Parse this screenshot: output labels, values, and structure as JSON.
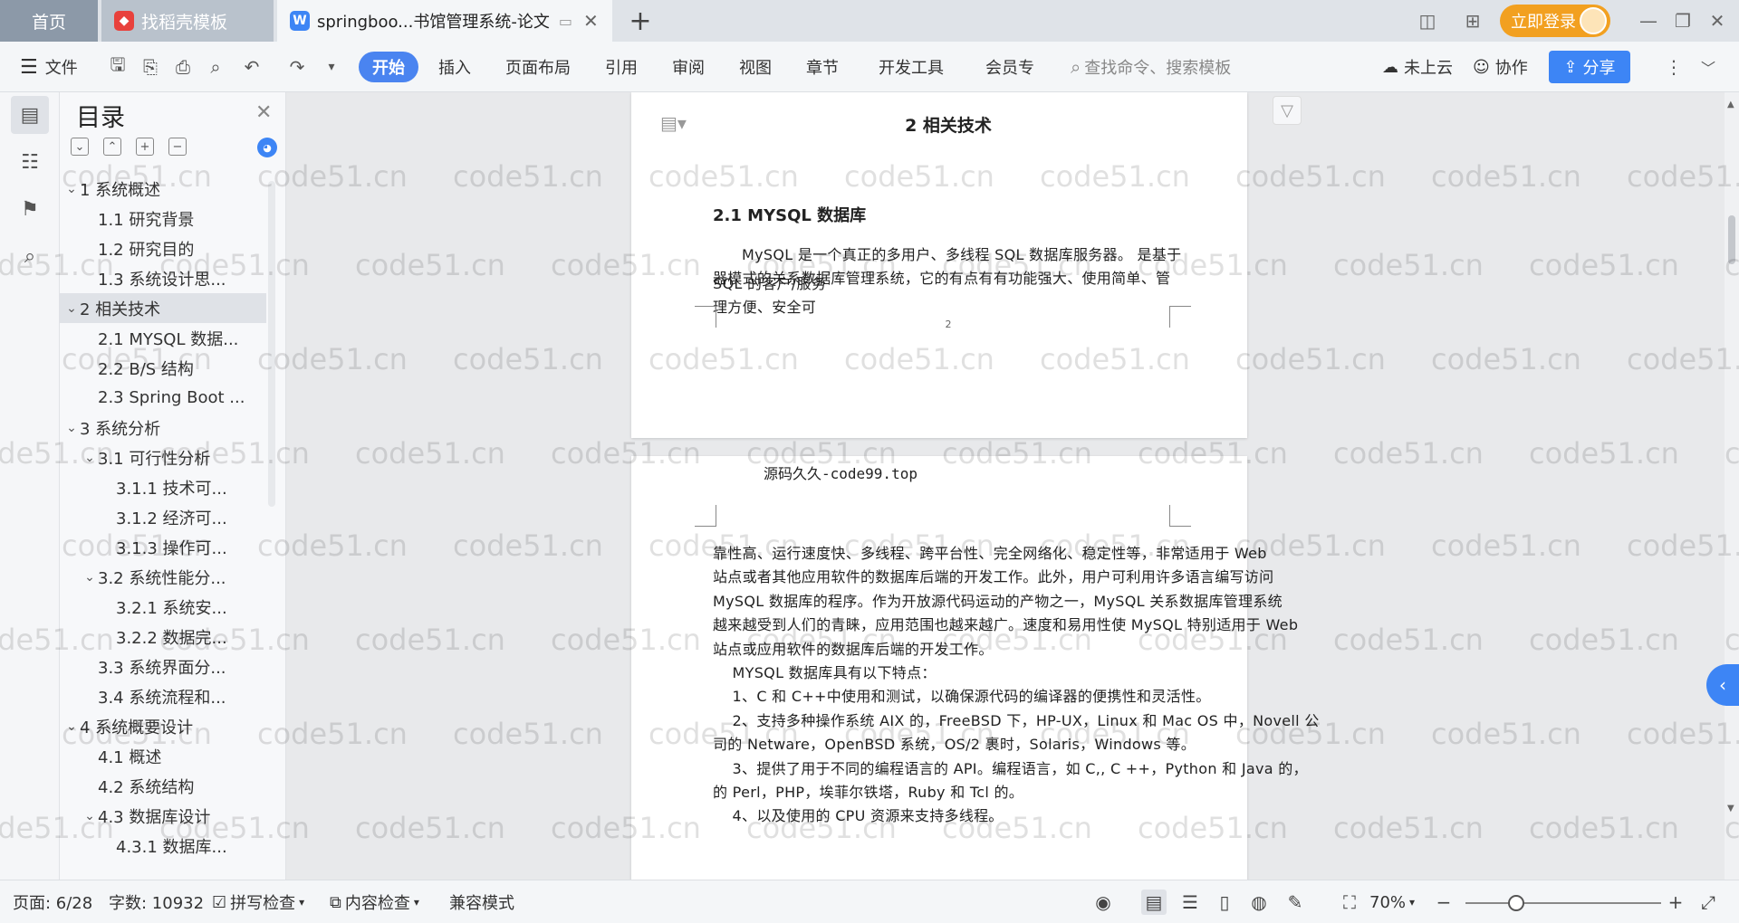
{
  "tabs": {
    "home": "首页",
    "daoke": "找稻壳模板",
    "doc": "springboo...书馆管理系统-论文",
    "add": "+"
  },
  "titlebar": {
    "login": "立即登录"
  },
  "ribbon": {
    "file": "文件",
    "items": [
      "开始",
      "插入",
      "页面布局",
      "引用",
      "审阅",
      "视图",
      "章节",
      "开发工具",
      "会员专"
    ],
    "search_placeholder": "查找命令、搜索模板",
    "cloud": "未上云",
    "collab": "协作",
    "share": "分享"
  },
  "toc": {
    "title": "目录",
    "items": [
      {
        "label": "1 系统概述",
        "level": 1,
        "expand": "open"
      },
      {
        "label": "1.1  研究背景",
        "level": 2
      },
      {
        "label": "1.2 研究目的",
        "level": 2
      },
      {
        "label": "1.3 系统设计思...",
        "level": 2
      },
      {
        "label": "2 相关技术",
        "level": 1,
        "expand": "open",
        "selected": true
      },
      {
        "label": "2.1 MYSQL 数据...",
        "level": 2
      },
      {
        "label": "2.2 B/S 结构",
        "level": 2
      },
      {
        "label": "2.3 Spring Boot ...",
        "level": 2
      },
      {
        "label": "3 系统分析",
        "level": 1,
        "expand": "open"
      },
      {
        "label": "3.1 可行性分析",
        "level": 2,
        "expand": "open"
      },
      {
        "label": "3.1.1 技术可...",
        "level": 3
      },
      {
        "label": "3.1.2 经济可...",
        "level": 3
      },
      {
        "label": "3.1.3 操作可...",
        "level": 3
      },
      {
        "label": "3.2 系统性能分...",
        "level": 2,
        "expand": "open"
      },
      {
        "label": "3.2.1  系统安...",
        "level": 3
      },
      {
        "label": "3.2.2  数据完...",
        "level": 3
      },
      {
        "label": "3.3 系统界面分...",
        "level": 2
      },
      {
        "label": "3.4 系统流程和...",
        "level": 2
      },
      {
        "label": "4 系统概要设计",
        "level": 1,
        "expand": "open"
      },
      {
        "label": "4.1 概述",
        "level": 2
      },
      {
        "label": "4.2 系统结构",
        "level": 2
      },
      {
        "label": "4.3 数据库设计",
        "level": 2,
        "expand": "open"
      },
      {
        "label": "4.3.1 数据库...",
        "level": 3
      }
    ]
  },
  "page1": {
    "chapter": "2 相关技术",
    "heading": "2.1 MYSQL 数据库",
    "para": [
      "MySQL 是一个真正的多用户、多线程 SQL 数据库服务器。 是基于 SQL 的客户/服务",
      "器模式的关系数据库管理系统，它的有点有有功能强大、使用简单、管理方便、安全可"
    ],
    "page_number": "2"
  },
  "page2": {
    "header": "源码久久-code99.top",
    "lines": [
      "靠性高、运行速度快、多线程、跨平台性、完全网络化、稳定性等，非常适用于 Web",
      "站点或者其他应用软件的数据库后端的开发工作。此外，用户可利用许多语言编写访问",
      "MySQL 数据库的程序。作为开放源代码运动的产物之一，MySQL 关系数据库管理系统",
      "越来越受到人们的青睐，应用范围也越来越广。速度和易用性使 MySQL 特别适用于 Web",
      "站点或应用软件的数据库后端的开发工作。",
      "    MYSQL 数据库具有以下特点：",
      "    1、C 和 C++中使用和测试，以确保源代码的编译器的便携性和灵活性。",
      "    2、支持多种操作系统 AIX 的，FreeBSD 下，HP-UX，Linux 和 Mac OS 中，Novell 公",
      "司的 Netware，OpenBSD 系统，OS/2 裹时，Solaris，Windows 等。",
      "    3、提供了用于不同的编程语言的 API。编程语言，如 C,, C ++，Python 和 Java 的，",
      "的 Perl，PHP，埃菲尔铁塔，Ruby 和 Tcl 的。",
      "    4、以及使用的 CPU 资源来支持多线程。"
    ]
  },
  "status": {
    "page": "页面: 6/28",
    "words": "字数: 10932",
    "spell": "拼写检查",
    "content": "内容检查",
    "compat": "兼容模式",
    "zoom": "70%",
    "zoom_fraction": 0.26
  },
  "watermark": "code51.cn",
  "colors": {
    "accent": "#3d85f5",
    "login": "#f2a020"
  }
}
